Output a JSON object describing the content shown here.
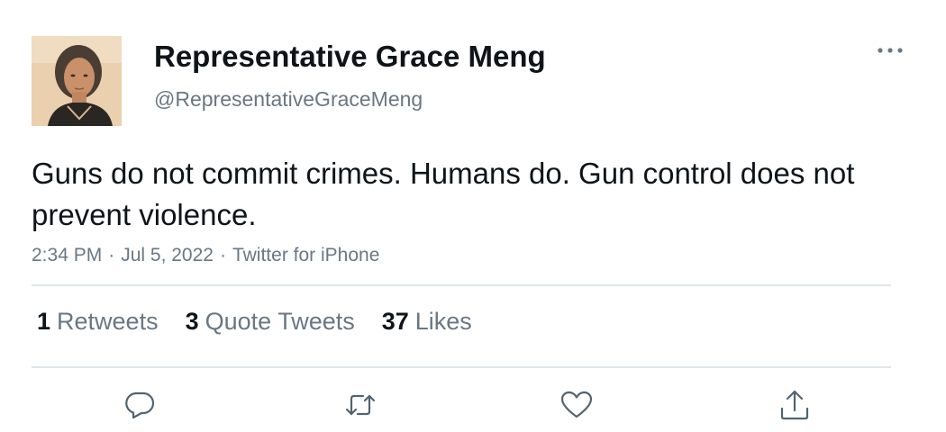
{
  "user": {
    "display_name": "Representative Grace Meng",
    "handle": "@RepresentativeGraceMeng",
    "avatar_icon": "profile-photo"
  },
  "tweet": {
    "text": "Guns do not commit crimes. Humans do. Gun control does not prevent violence.",
    "time": "2:34 PM",
    "date": "Jul 5, 2022",
    "source": "Twitter for iPhone",
    "separator": "·"
  },
  "stats": {
    "retweets": {
      "count": "1",
      "label": "Retweets"
    },
    "quote_tweets": {
      "count": "3",
      "label": "Quote Tweets"
    },
    "likes": {
      "count": "37",
      "label": "Likes"
    }
  },
  "actions": {
    "reply_icon": "reply-icon",
    "retweet_icon": "retweet-icon",
    "like_icon": "heart-icon",
    "share_icon": "share-icon"
  },
  "colors": {
    "text_primary": "#0f1419",
    "text_secondary": "#6a7782",
    "divider": "#e1e6ea",
    "icon": "#536471"
  }
}
